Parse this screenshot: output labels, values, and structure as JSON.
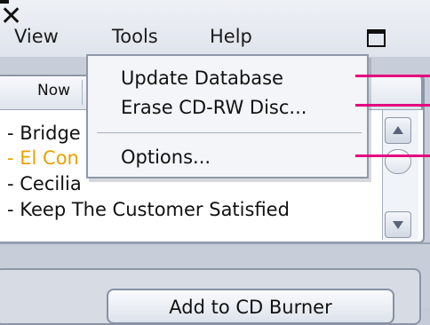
{
  "menubar": {
    "items": [
      "View",
      "Tools",
      "Help"
    ]
  },
  "window_controls": {
    "minimize": "minimize-icon",
    "maximize": "maximize-icon",
    "close": "close-icon",
    "close_glyph": "✕"
  },
  "playlist": {
    "tab_label": "Now",
    "tracks": [
      {
        "text": "- Bridge",
        "state": "normal"
      },
      {
        "text": "- El Con",
        "state": "playing"
      },
      {
        "text": "- Cecilia",
        "state": "normal"
      },
      {
        "text": "- Keep The Customer Satisfied",
        "state": "normal"
      }
    ],
    "playing_color": "#e6a200"
  },
  "tools_menu": {
    "items": [
      "Update Database",
      "Erase CD-RW Disc...",
      "Options..."
    ]
  },
  "footer": {
    "burn_button_label": "Add to CD Burner"
  },
  "callout_color": "#e4007f"
}
